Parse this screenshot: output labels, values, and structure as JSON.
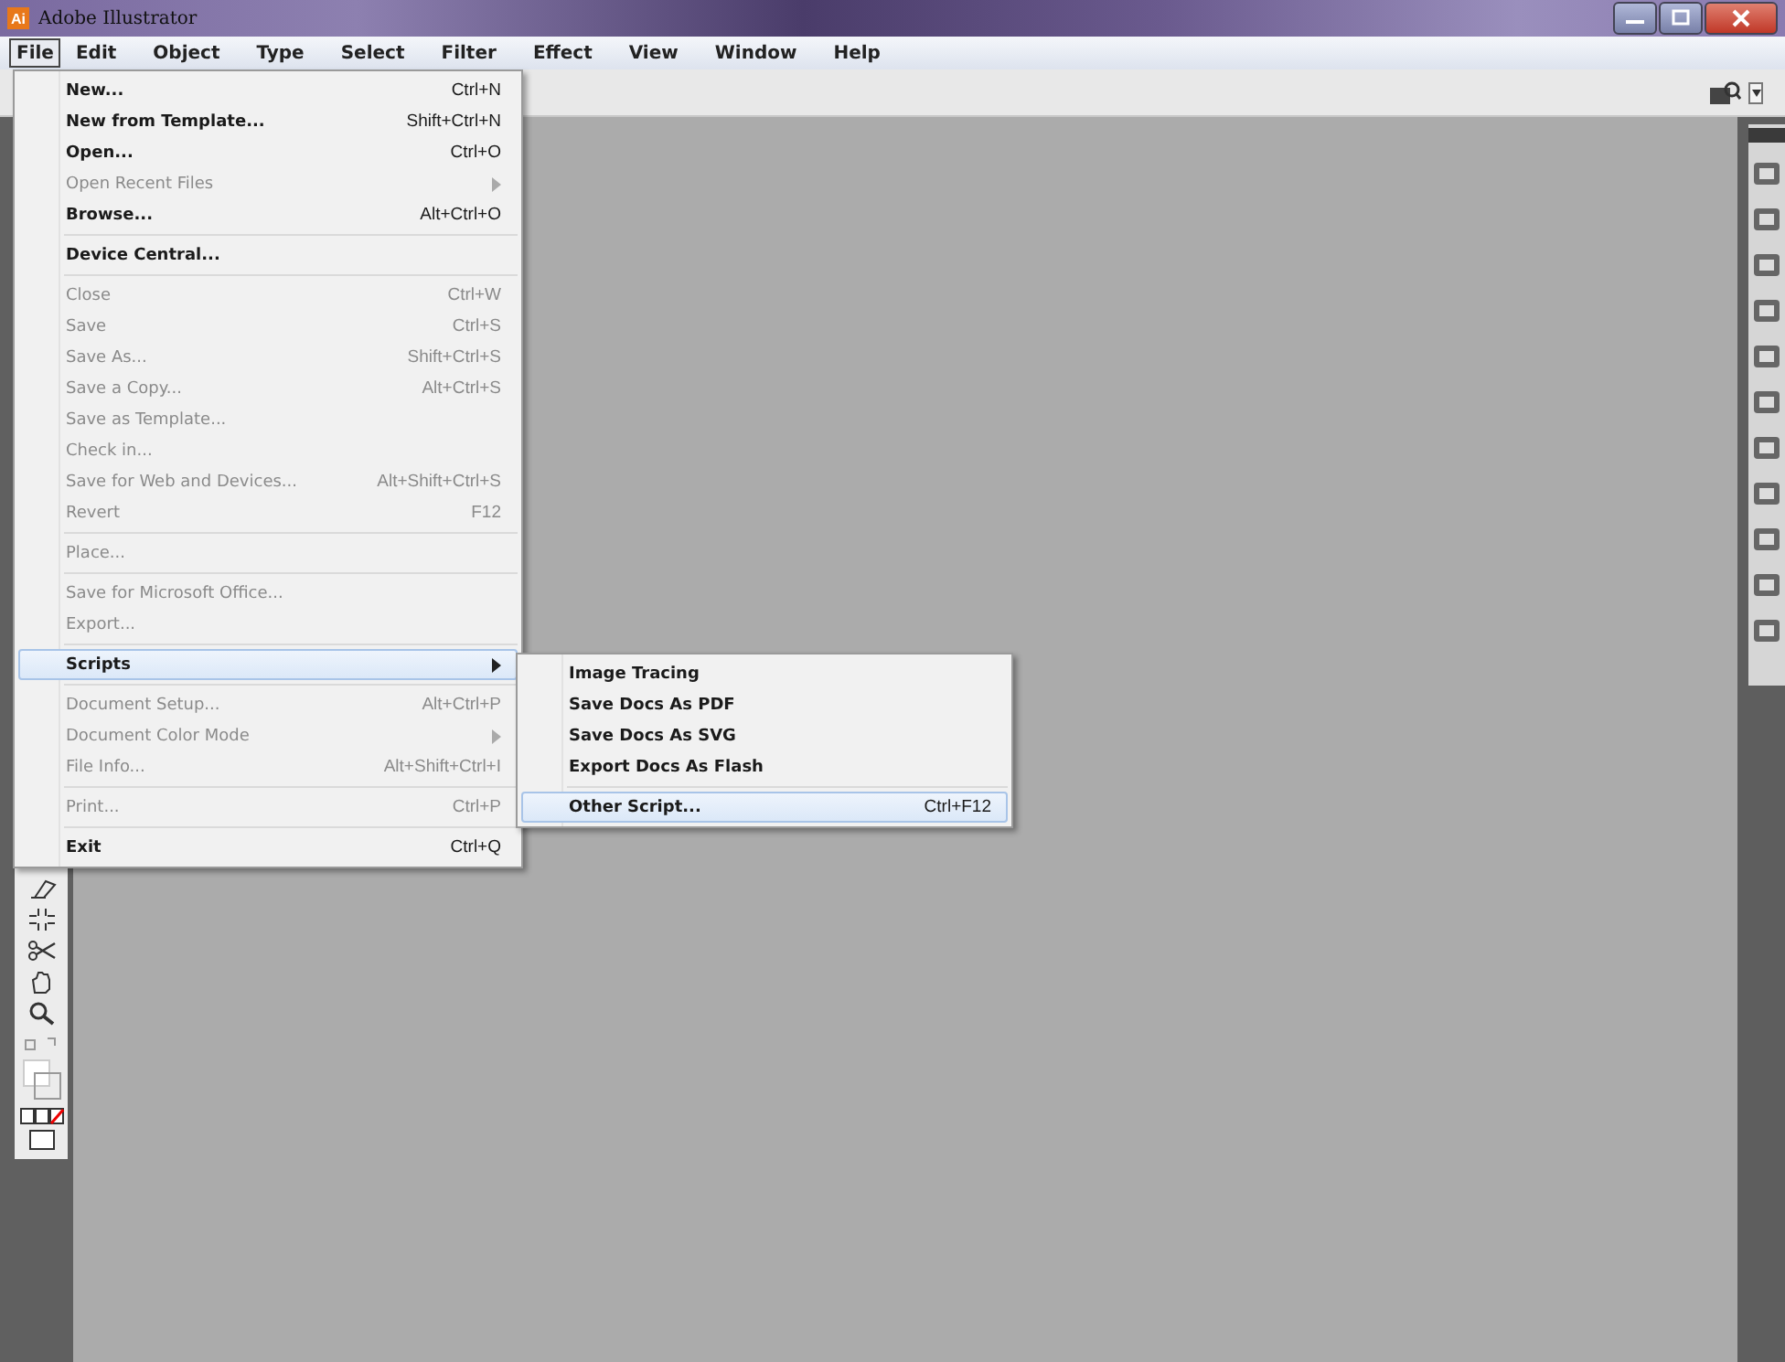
{
  "window": {
    "title": "Adobe Illustrator",
    "app_icon_text": "Ai"
  },
  "menu_bar": [
    {
      "label": "File",
      "selected": true
    },
    {
      "label": "Edit",
      "selected": false
    },
    {
      "label": "Object",
      "selected": false
    },
    {
      "label": "Type",
      "selected": false
    },
    {
      "label": "Select",
      "selected": false
    },
    {
      "label": "Filter",
      "selected": false
    },
    {
      "label": "Effect",
      "selected": false
    },
    {
      "label": "View",
      "selected": false
    },
    {
      "label": "Window",
      "selected": false
    },
    {
      "label": "Help",
      "selected": false
    }
  ],
  "file_menu": [
    {
      "kind": "item",
      "label": "New...",
      "shortcut": "Ctrl+N",
      "disabled": false,
      "submenu": false,
      "selected": false
    },
    {
      "kind": "item",
      "label": "New from Template...",
      "shortcut": "Shift+Ctrl+N",
      "disabled": false,
      "submenu": false,
      "selected": false
    },
    {
      "kind": "item",
      "label": "Open...",
      "shortcut": "Ctrl+O",
      "disabled": false,
      "submenu": false,
      "selected": false
    },
    {
      "kind": "item",
      "label": "Open Recent Files",
      "disabled": true,
      "submenu": true,
      "selected": false
    },
    {
      "kind": "item",
      "label": "Browse...",
      "shortcut": "Alt+Ctrl+O",
      "disabled": false,
      "submenu": false,
      "selected": false
    },
    {
      "kind": "separator"
    },
    {
      "kind": "item",
      "label": "Device Central...",
      "disabled": false,
      "submenu": false,
      "selected": false
    },
    {
      "kind": "separator"
    },
    {
      "kind": "item",
      "label": "Close",
      "shortcut": "Ctrl+W",
      "disabled": true,
      "submenu": false,
      "selected": false
    },
    {
      "kind": "item",
      "label": "Save",
      "shortcut": "Ctrl+S",
      "disabled": true,
      "submenu": false,
      "selected": false
    },
    {
      "kind": "item",
      "label": "Save As...",
      "shortcut": "Shift+Ctrl+S",
      "disabled": true,
      "submenu": false,
      "selected": false
    },
    {
      "kind": "item",
      "label": "Save a Copy...",
      "shortcut": "Alt+Ctrl+S",
      "disabled": true,
      "submenu": false,
      "selected": false
    },
    {
      "kind": "item",
      "label": "Save as Template...",
      "disabled": true,
      "submenu": false,
      "selected": false
    },
    {
      "kind": "item",
      "label": "Check in...",
      "disabled": true,
      "submenu": false,
      "selected": false
    },
    {
      "kind": "item",
      "label": "Save for Web and Devices...",
      "shortcut": "Alt+Shift+Ctrl+S",
      "disabled": true,
      "submenu": false,
      "selected": false
    },
    {
      "kind": "item",
      "label": "Revert",
      "shortcut": "F12",
      "disabled": true,
      "submenu": false,
      "selected": false
    },
    {
      "kind": "separator"
    },
    {
      "kind": "item",
      "label": "Place...",
      "disabled": true,
      "submenu": false,
      "selected": false
    },
    {
      "kind": "separator"
    },
    {
      "kind": "item",
      "label": "Save for Microsoft Office...",
      "disabled": true,
      "submenu": false,
      "selected": false
    },
    {
      "kind": "item",
      "label": "Export...",
      "disabled": true,
      "submenu": false,
      "selected": false
    },
    {
      "kind": "separator"
    },
    {
      "kind": "item",
      "label": "Scripts",
      "disabled": false,
      "submenu": true,
      "selected": true
    },
    {
      "kind": "separator"
    },
    {
      "kind": "item",
      "label": "Document Setup...",
      "shortcut": "Alt+Ctrl+P",
      "disabled": true,
      "submenu": false,
      "selected": false
    },
    {
      "kind": "item",
      "label": "Document Color Mode",
      "disabled": true,
      "submenu": true,
      "selected": false
    },
    {
      "kind": "item",
      "label": "File Info...",
      "shortcut": "Alt+Shift+Ctrl+I",
      "disabled": true,
      "submenu": false,
      "selected": false
    },
    {
      "kind": "separator"
    },
    {
      "kind": "item",
      "label": "Print...",
      "shortcut": "Ctrl+P",
      "disabled": true,
      "submenu": false,
      "selected": false
    },
    {
      "kind": "separator"
    },
    {
      "kind": "item",
      "label": "Exit",
      "shortcut": "Ctrl+Q",
      "disabled": false,
      "submenu": false,
      "selected": false
    }
  ],
  "scripts_menu": [
    {
      "kind": "item",
      "label": "Image Tracing",
      "selected": false
    },
    {
      "kind": "item",
      "label": "Save Docs As PDF",
      "selected": false
    },
    {
      "kind": "item",
      "label": "Save Docs As SVG",
      "selected": false
    },
    {
      "kind": "item",
      "label": "Export Docs As Flash",
      "selected": false
    },
    {
      "kind": "separator"
    },
    {
      "kind": "item",
      "label": "Other Script...",
      "shortcut": "Ctrl+F12",
      "selected": true
    }
  ]
}
